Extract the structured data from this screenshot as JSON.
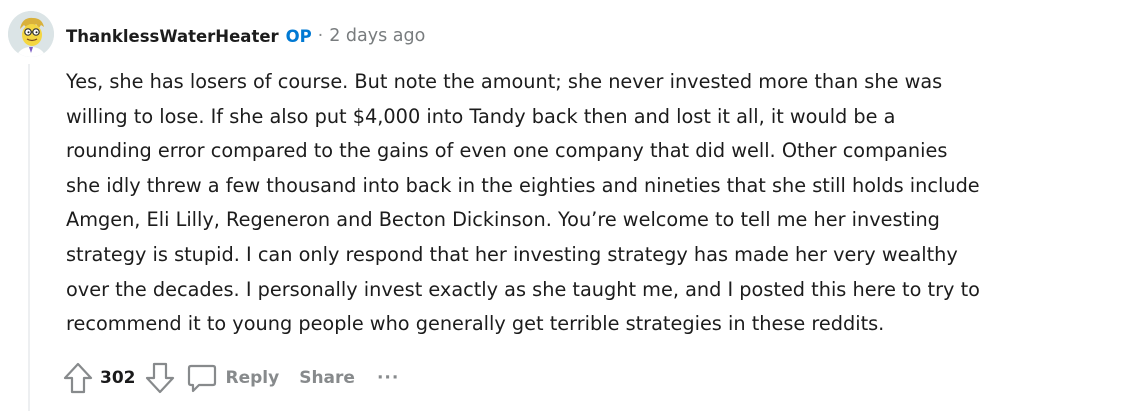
{
  "comment": {
    "author": "ThanklessWaterHeater",
    "op_badge": "OP",
    "separator": "·",
    "timestamp": "2 days ago",
    "body_lines": [
      "Yes, she has losers of course. But note the amount; she never invested more than she was",
      "willing to lose. If she also put $4,000 into Tandy back then and lost it all, it would be a",
      "rounding error compared to the gains of even one company that did well. Other companies",
      "she idly threw a few thousand into back in the eighties and nineties that she still holds include",
      "Amgen, Eli Lilly, Regeneron and Becton Dickinson. You’re welcome to tell me her investing",
      "strategy is stupid. I can only respond that her investing strategy has made her very wealthy",
      "over the decades. I personally invest exactly as she taught me, and I posted this here to try to",
      "recommend it to young people who generally get terrible strategies in these reddits."
    ],
    "score": "302",
    "actions": {
      "reply_label": "Reply",
      "share_label": "Share",
      "more_label": "···"
    },
    "icons": {
      "avatar": "avatar-icon",
      "upvote": "upvote-arrow-icon",
      "downvote": "downvote-arrow-icon",
      "reply": "speech-bubble-icon",
      "more": "more-options-icon"
    },
    "colors": {
      "op": "#0079d3",
      "muted": "#878a8c",
      "text": "#1c1c1c"
    }
  }
}
